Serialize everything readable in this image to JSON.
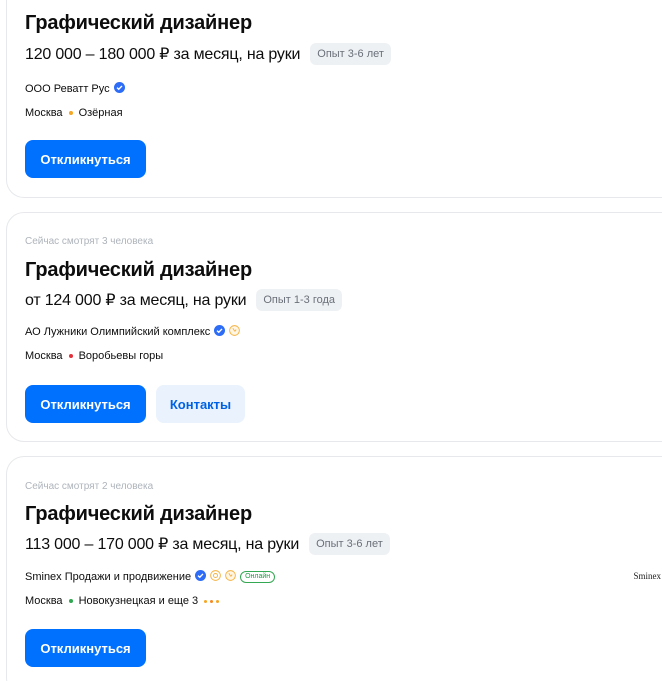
{
  "vacancies": [
    {
      "title": "Графический дизайнер",
      "salary": "120 000 – 180 000 ₽ за месяц, на руки",
      "experience": "Опыт 3-6 лет",
      "company": "ООО Реватт Рус",
      "city": "Москва",
      "metro": "Озёрная",
      "metro_color": "#f5a623",
      "apply_label": "Откликнуться"
    },
    {
      "watching": "Сейчас смотрят 3 человека",
      "title": "Графический дизайнер",
      "salary": "от 124 000 ₽ за месяц, на руки",
      "experience": "Опыт 1-3 года",
      "company": "АО Лужники Олимпийский комплекс",
      "city": "Москва",
      "metro": "Воробьевы горы",
      "metro_color": "#e4303a",
      "apply_label": "Откликнуться",
      "contacts_label": "Контакты"
    },
    {
      "watching": "Сейчас смотрят 2 человека",
      "title": "Графический дизайнер",
      "salary": "113 000 – 170 000 ₽ за месяц, на руки",
      "experience": "Опыт 3-6 лет",
      "company": "Sminex Продажи и продвижение",
      "online_label": "Онлайн",
      "city": "Москва",
      "metro": "Новокузнецкая и еще 3",
      "metro_color": "#2fa84f",
      "extra_metro_colors": [
        "#f5a623",
        "#f58a1f",
        "#f5a623"
      ],
      "logo_text": "Sminex",
      "apply_label": "Откликнуться"
    }
  ],
  "colors": {
    "primary": "#0070ff",
    "verified": "#2d6cf6",
    "rating": "#f5b342"
  }
}
